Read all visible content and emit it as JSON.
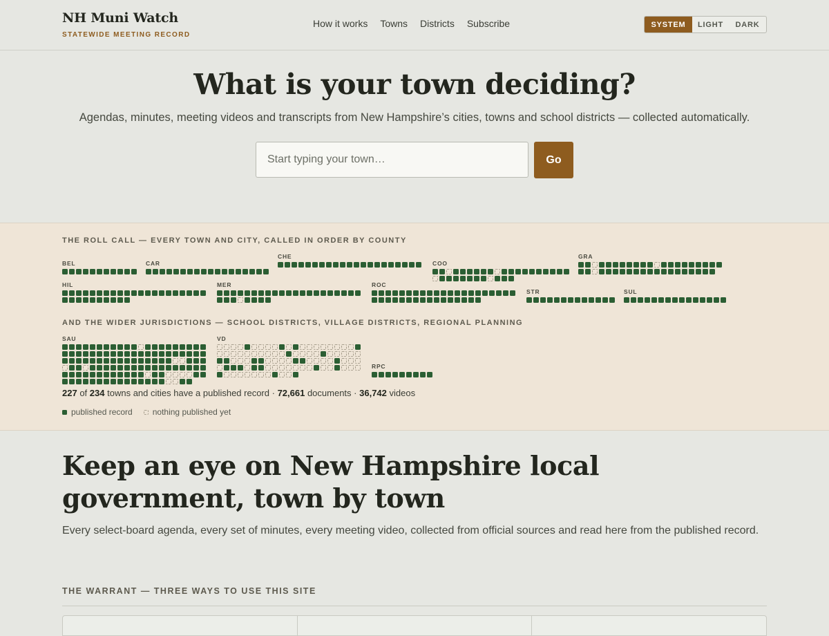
{
  "header": {
    "title": "NH Muni Watch",
    "subtitle": "STATEWIDE MEETING RECORD",
    "nav": [
      "How it works",
      "Towns",
      "Districts",
      "Subscribe"
    ],
    "theme": {
      "options": [
        "SYSTEM",
        "LIGHT",
        "DARK"
      ],
      "selected": "SYSTEM"
    }
  },
  "hero": {
    "title": "What is your town deciding?",
    "subtitle": "Agendas, minutes, meeting videos and transcripts from New Hampshire’s cities, towns and school districts — collected automatically.",
    "search_placeholder": "Start typing your town…",
    "go_label": "Go"
  },
  "rollcall": {
    "heading": "THE ROLL CALL — EVERY TOWN AND CITY, CALLED IN ORDER BY COUNTY",
    "counties": [
      {
        "code": "BEL",
        "pattern": "11111111111"
      },
      {
        "code": "CAR",
        "pattern": "111111111111111111"
      },
      {
        "code": "CHE",
        "pattern": "11111111111111111111122"
      },
      {
        "code": "COO",
        "pattern": "11011111101111111111011111110111"
      },
      {
        "code": "GRA",
        "pattern": "11011111111011111111111011111111111111111"
      },
      {
        "code": "HIL",
        "pattern": "11111111111111111111111111111131"
      },
      {
        "code": "MER",
        "pattern": "11111111111111111111111101111"
      },
      {
        "code": "ROC",
        "pattern": "1111111111111111111111111111111111111"
      },
      {
        "code": "STR",
        "pattern": "1111111111111"
      },
      {
        "code": "SUL",
        "pattern": "111111111111111"
      }
    ],
    "wider_heading": "AND THE WIDER JURISDICTIONS — SCHOOL DISTRICTS, VILLAGE DISTRICTS, REGIONAL PLANNING",
    "wider": [
      {
        "code": "SAU",
        "pattern": "1111111111101111111111111111111111111111111111111111111111001110110111111111111111111111111111110110000111111111111111110011"
      },
      {
        "code": "VD",
        "pattern": "000010000101000000001000000000010000100000110001100001100001000011101100000001001000100000001001"
      },
      {
        "code": "RPC",
        "pattern": "111111111"
      }
    ],
    "stats": {
      "towns_published": "227",
      "of": "of",
      "towns_total": "234",
      "towns_text": "towns and cities have a published record ·",
      "documents": "72,661",
      "documents_text": "documents ·",
      "videos": "36,742",
      "videos_text": "videos"
    },
    "legend": {
      "published": "published record",
      "empty": "nothing published yet"
    }
  },
  "lower": {
    "title": "Keep an eye on New Hampshire local government, town by town",
    "subtitle": "Every select-board agenda, every set of minutes, every meeting video, collected from official sources and read here from the published record.",
    "warrant_heading": "THE WARRANT — THREE WAYS TO USE THIS SITE"
  },
  "colors": {
    "accent": "#8e5c1f",
    "published_dot": "#2b5e33",
    "band_bg": "#efe5d7",
    "page_bg": "#e6e7e2"
  }
}
